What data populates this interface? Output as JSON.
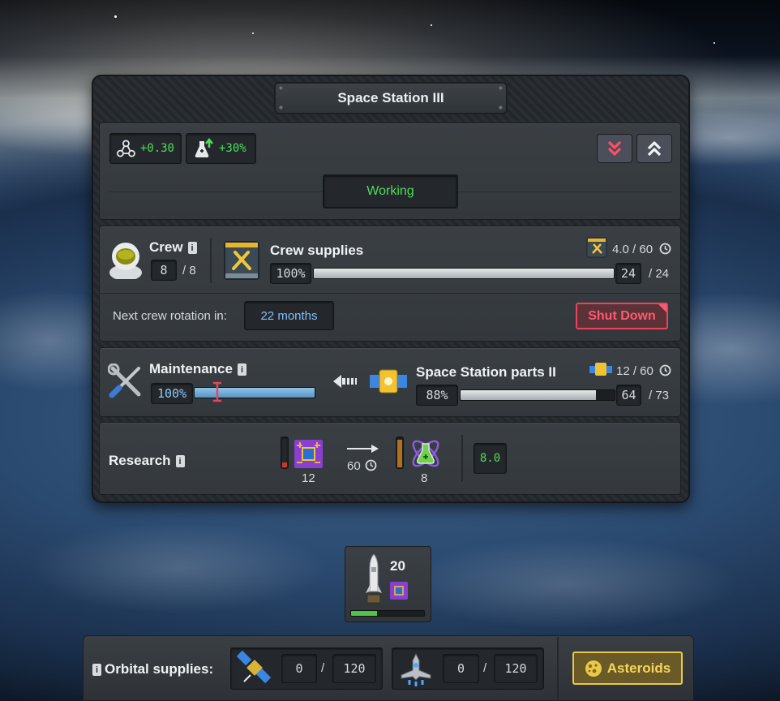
{
  "station": {
    "title": "Space Station III",
    "status": "Working",
    "stat_network": "+0.30",
    "stat_research_bonus": "+30%"
  },
  "crew": {
    "label": "Crew",
    "current": "8",
    "max": "/ 8",
    "next_rotation_label": "Next crew rotation in:",
    "next_rotation_value": "22 months",
    "shutdown_label": "Shut Down"
  },
  "crew_supplies": {
    "label": "Crew supplies",
    "rate": "4.0 / 60",
    "percent": "100%",
    "fill_fraction": 1.0,
    "current": "24",
    "max": "/ 24"
  },
  "maintenance": {
    "label": "Maintenance",
    "percent": "100%",
    "fill_fraction": 1.0
  },
  "station_parts": {
    "label": "Space Station parts II",
    "rate": "12 / 60",
    "percent": "88%",
    "fill_fraction": 0.88,
    "current": "64",
    "max": "/ 73"
  },
  "research": {
    "label": "Research",
    "input_amount": "12",
    "time": "60",
    "output_amount": "8",
    "rate": "8.0"
  },
  "rocket": {
    "count": "20",
    "progress_fraction": 0.35
  },
  "orbital": {
    "label": "Orbital supplies:",
    "satellite_current": "0",
    "satellite_max": "120",
    "ship_current": "0",
    "ship_max": "120",
    "slash": "/",
    "asteroids_label": "Asteroids"
  },
  "colors": {
    "green": "#4fdc5a",
    "red": "#e8455a",
    "blue_value": "#7fc0ff",
    "gold": "#e8c94a"
  },
  "icons": {
    "network": "network-nodes-icon",
    "research_bonus": "flask-upgrade-icon",
    "collapse": "double-chevron-down-icon",
    "expand": "double-chevron-up-icon",
    "astronaut": "astronaut-helmet-icon",
    "supplies": "crew-supplies-crate-icon",
    "clock": "clock-icon",
    "tools": "wrench-screwdriver-icon",
    "arrow": "arrow-left-icon",
    "station_part": "station-module-icon",
    "chip": "circuit-chip-icon",
    "atom_flask": "atom-flask-icon",
    "rocket": "rocket-icon",
    "satellite": "satellite-icon",
    "ship": "spaceship-icon",
    "asteroid": "asteroid-icon"
  }
}
